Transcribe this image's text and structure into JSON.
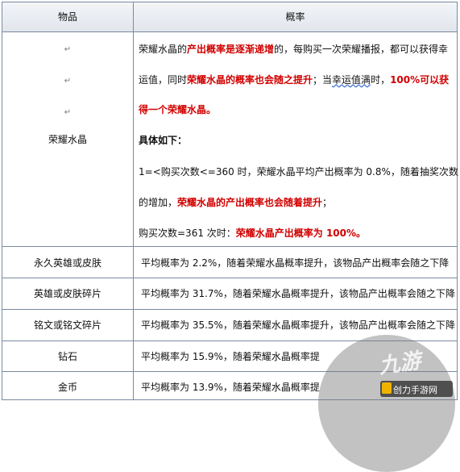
{
  "header": {
    "col_item": "物品",
    "col_rate": "概率"
  },
  "para_mark": "↵",
  "glory": {
    "item": "荣耀水晶",
    "line1_a": "荣耀水晶的",
    "line1_b": "产出概率是逐渐递增",
    "line1_c": "的，每购买一次荣耀播报，都可以获得幸",
    "line2_a": "运值，同时",
    "line2_b": "荣耀水晶的概率也会随之提升",
    "line2_c": "；当",
    "line2_d": "幸运值满",
    "line2_e": "时，",
    "line2_f": "100%可以获",
    "line3": "得一个荣耀水晶。",
    "line4": "具体如下：",
    "line5": "1=<购买次数<=360 时，荣耀水晶平均产出概率为 0.8%，随着抽奖次数",
    "line6_a": "的增加，",
    "line6_b": "荣耀水晶的产出概率也会随着提升",
    "line6_c": "；",
    "line7_a": "购买次数=361 次时：",
    "line7_b": "荣耀水晶产出概率为 100%。"
  },
  "rows": [
    {
      "item": "永久英雄或皮肤",
      "rate": "平均概率为 2.2%，随着荣耀水晶概率提升，该物品产出概率会随之下降"
    },
    {
      "item": "英雄或皮肤碎片",
      "rate": "平均概率为 31.7%，随着荣耀水晶概率提升，该物品产出概率会随之下降"
    },
    {
      "item": "铭文或铭文碎片",
      "rate": "平均概率为 35.5%，随着荣耀水晶概率提升，该物品产出概率会随之下降"
    },
    {
      "item": "钻石",
      "rate": "平均概率为 15.9%，随着荣耀水晶概率提"
    },
    {
      "item": "金币",
      "rate": "平均概率为 13.9%，随着荣耀水晶概率提"
    }
  ],
  "watermark": {
    "logo_text": "九游",
    "site": "创力手游网"
  }
}
